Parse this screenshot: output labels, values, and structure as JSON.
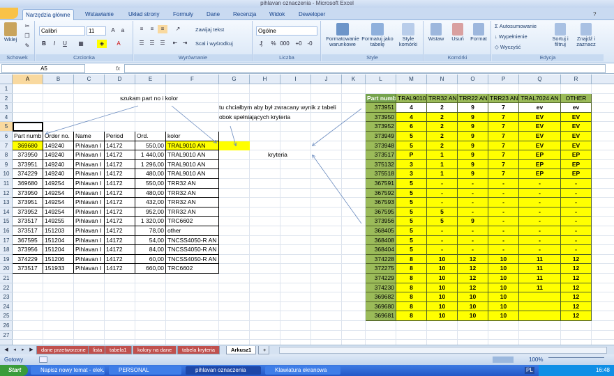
{
  "window": {
    "title": "pihlavan oznaczenia - Microsoft Excel"
  },
  "ribbon": {
    "tabs": [
      "Narzędzia główne",
      "Wstawianie",
      "Układ strony",
      "Formuły",
      "Dane",
      "Recenzja",
      "Widok",
      "Deweloper"
    ],
    "active_tab": "Narzędzia główne",
    "paste_label": "Wklej",
    "clipboard_group": "Schowek",
    "font_name": "Calibri",
    "font_size": "11",
    "font_group": "Czcionka",
    "wrap_text": "Zawijaj tekst",
    "merge_center": "Scal i wyśrodkuj",
    "alignment_group": "Wyrównanie",
    "number_format": "Ogólne",
    "number_group": "Liczba",
    "cond_format": "Formatowanie warunkowe",
    "format_table": "Formatuj jako tabelę",
    "cell_styles": "Style komórki",
    "styles_group": "Style",
    "insert": "Wstaw",
    "delete": "Usuń",
    "format": "Format",
    "cells_group": "Komórki",
    "autosum": "Autosumowanie",
    "fill": "Wypełnienie",
    "clear": "Wyczyść",
    "sort_filter": "Sortuj i filtruj",
    "find_select": "Znajdź i zaznacz",
    "editing_group": "Edycja",
    "bold": "B",
    "italic": "I",
    "underline": "U",
    "fx": "fx"
  },
  "formula_bar": {
    "name_box": "A5",
    "formula": ""
  },
  "columns": [
    "A",
    "B",
    "C",
    "D",
    "E",
    "F",
    "G",
    "H",
    "I",
    "J",
    "K",
    "L",
    "M",
    "N",
    "O",
    "P",
    "Q",
    "R"
  ],
  "rows": [
    "1",
    "2",
    "3",
    "4",
    "5",
    "6",
    "7",
    "8",
    "9",
    "10",
    "11",
    "12",
    "13",
    "14",
    "15",
    "16",
    "17",
    "18",
    "19",
    "20",
    "21",
    "22",
    "23",
    "24",
    "25",
    "26",
    "27"
  ],
  "left_table": {
    "headers": [
      "Part numb",
      "Order no.",
      "Name",
      "Period",
      "Ord.",
      "kolor"
    ],
    "rows": [
      [
        "369680",
        "149240",
        "Pihlavan I",
        "14172",
        "550,00",
        "TRAL9010 AN"
      ],
      [
        "373950",
        "149240",
        "Pihlavan I",
        "14172",
        "1 440,00",
        "TRAL9010 AN"
      ],
      [
        "373951",
        "149240",
        "Pihlavan I",
        "14172",
        "1 296,00",
        "TRAL9010 AN"
      ],
      [
        "374229",
        "149240",
        "Pihlavan I",
        "14172",
        "480,00",
        "TRAL9010 AN"
      ],
      [
        "369680",
        "149254",
        "Pihlavan I",
        "14172",
        "550,00",
        "TRR32 AN"
      ],
      [
        "373950",
        "149254",
        "Pihlavan I",
        "14172",
        "480,00",
        "TRR32 AN"
      ],
      [
        "373951",
        "149254",
        "Pihlavan I",
        "14172",
        "432,00",
        "TRR32 AN"
      ],
      [
        "373952",
        "149254",
        "Pihlavan I",
        "14172",
        "952,00",
        "TRR32 AN"
      ],
      [
        "373517",
        "149255",
        "Pihlavan I",
        "14172",
        "1 320,00",
        "TRC6602"
      ],
      [
        "373517",
        "151203",
        "Pihlavan I",
        "14172",
        "78,00",
        "other"
      ],
      [
        "367595",
        "151204",
        "Pihlavan I",
        "14172",
        "54,00",
        "TNCSS4050-R AN"
      ],
      [
        "373956",
        "151204",
        "Pihlavan I",
        "14172",
        "84,00",
        "TNCSS4050-R AN"
      ],
      [
        "374229",
        "151206",
        "Pihlavan I",
        "14172",
        "60,00",
        "TNCSS4050-R AN"
      ],
      [
        "373517",
        "151933",
        "Pihlavan I",
        "14172",
        "660,00",
        "TRC6602"
      ]
    ]
  },
  "right_table": {
    "headers": [
      "Part numb",
      "TRAL9010 AN",
      "TRR32 AN",
      "TRR22 AN",
      "TRR23 AN",
      "TRAL7024 AN",
      "OTHER"
    ],
    "rows": [
      [
        "373951",
        "4",
        "2",
        "9",
        "7",
        "ev",
        "ev"
      ],
      [
        "373950",
        "4",
        "2",
        "9",
        "7",
        "EV",
        "EV"
      ],
      [
        "373952",
        "6",
        "2",
        "9",
        "7",
        "EV",
        "EV"
      ],
      [
        "373949",
        "5",
        "2",
        "9",
        "7",
        "EV",
        "EV"
      ],
      [
        "373948",
        "5",
        "2",
        "9",
        "7",
        "EV",
        "EV"
      ],
      [
        "373517",
        "P",
        "1",
        "9",
        "7",
        "EP",
        "EP"
      ],
      [
        "375132",
        "3",
        "1",
        "9",
        "7",
        "EP",
        "EP"
      ],
      [
        "375518",
        "3",
        "1",
        "9",
        "7",
        "EP",
        "EP"
      ],
      [
        "367591",
        "5",
        "-",
        "-",
        "-",
        "-",
        "-"
      ],
      [
        "367592",
        "5",
        "-",
        "-",
        "-",
        "-",
        "-"
      ],
      [
        "367593",
        "5",
        "-",
        "-",
        "-",
        "-",
        "-"
      ],
      [
        "367595",
        "5",
        "5",
        "-",
        "-",
        "-",
        "-"
      ],
      [
        "373956",
        "5",
        "5",
        "9",
        "-",
        "-",
        "-"
      ],
      [
        "368405",
        "5",
        "-",
        "-",
        "-",
        "-",
        "-"
      ],
      [
        "368408",
        "5",
        "-",
        "-",
        "-",
        "-",
        "-"
      ],
      [
        "368404",
        "5",
        "-",
        "-",
        "-",
        "-",
        "-"
      ],
      [
        "374228",
        "8",
        "10",
        "12",
        "10",
        "11",
        "12"
      ],
      [
        "372275",
        "8",
        "10",
        "12",
        "10",
        "11",
        "12"
      ],
      [
        "374229",
        "8",
        "10",
        "12",
        "10",
        "11",
        "12"
      ],
      [
        "374230",
        "8",
        "10",
        "12",
        "10",
        "11",
        "12"
      ],
      [
        "369682",
        "8",
        "10",
        "10",
        "10",
        "",
        "12"
      ],
      [
        "369680",
        "8",
        "10",
        "10",
        "10",
        "",
        "12"
      ],
      [
        "369681",
        "8",
        "10",
        "10",
        "10",
        "",
        "12"
      ]
    ]
  },
  "annotations": {
    "search": "szukam part no i kolor",
    "result_line1": "tu chciałbym aby był zwracany wynik z tabeli",
    "result_line2": "obok spełniających kryteria",
    "criteria": "kryteria"
  },
  "sheets": {
    "tabs": [
      "dane przetworzone",
      "lista",
      "tabela1",
      "kolory na dane",
      "tabela kryteria",
      "Arkusz1"
    ],
    "active": "Arkusz1"
  },
  "status": {
    "ready": "Gotowy",
    "zoom": "100%"
  },
  "taskbar": {
    "start": "Start",
    "items": [
      "Napisz nowy temat - elek...",
      "PERSONAL",
      "pihlavan oznaczenia",
      "Klawiatura ekranowa"
    ],
    "lang": "PL",
    "clock": "16:48"
  },
  "colors": {
    "yellow": "#ffff00",
    "green": "#9bbb59",
    "header_green": "#76a34d"
  }
}
